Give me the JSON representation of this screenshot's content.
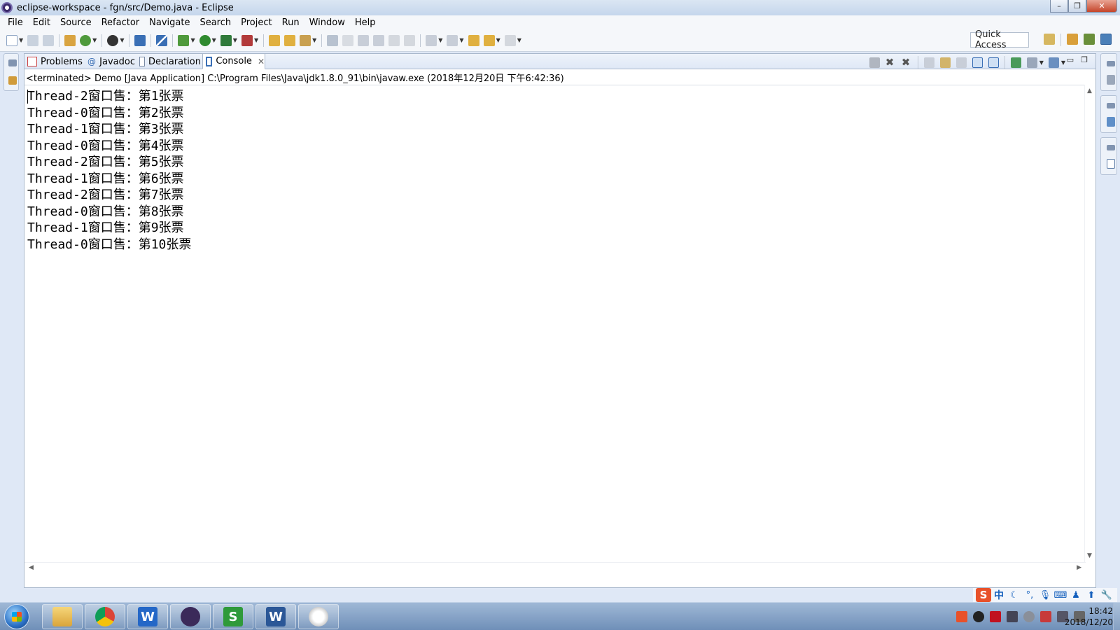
{
  "window": {
    "title": "eclipse-workspace - fgn/src/Demo.java - Eclipse",
    "controls": [
      "–",
      "❐",
      "✕"
    ]
  },
  "menu": [
    "File",
    "Edit",
    "Source",
    "Refactor",
    "Navigate",
    "Search",
    "Project",
    "Run",
    "Window",
    "Help"
  ],
  "toolbar": {
    "quick_access": "Quick Access"
  },
  "tabs": [
    {
      "label": "Problems",
      "icon": "problems-icon"
    },
    {
      "label": "Javadoc",
      "icon": "javadoc-icon"
    },
    {
      "label": "Declaration",
      "icon": "declaration-icon"
    },
    {
      "label": "Console",
      "icon": "console-icon",
      "active": true
    }
  ],
  "console": {
    "header": "<terminated> Demo [Java Application] C:\\Program Files\\Java\\jdk1.8.0_91\\bin\\javaw.exe (2018年12月20日 下午6:42:36)",
    "lines": [
      "Thread-2窗口售：第1张票",
      "Thread-0窗口售：第2张票",
      "Thread-1窗口售：第3张票",
      "Thread-0窗口售：第4张票",
      "Thread-2窗口售：第5张票",
      "Thread-1窗口售：第6张票",
      "Thread-2窗口售：第7张票",
      "Thread-0窗口售：第8张票",
      "Thread-1窗口售：第9张票",
      "Thread-0窗口售：第10张票"
    ]
  },
  "ime": {
    "logo": "S",
    "mode": "中",
    "icons": [
      "moon-icon",
      "punct-icon",
      "mic-icon",
      "keyboard-icon",
      "user-icon",
      "shirt-icon",
      "wrench-icon"
    ]
  },
  "taskbar": {
    "apps": [
      "explorer",
      "chrome",
      "wps-writer",
      "java-ee-ide",
      "wps-spreadsheet",
      "word",
      "media"
    ],
    "clock_time": "18:42",
    "clock_date": "2018/12/20"
  },
  "colors": {
    "accent": "#1560bd",
    "ime_red": "#e8512a",
    "taskbar": "#6f8fb8"
  }
}
